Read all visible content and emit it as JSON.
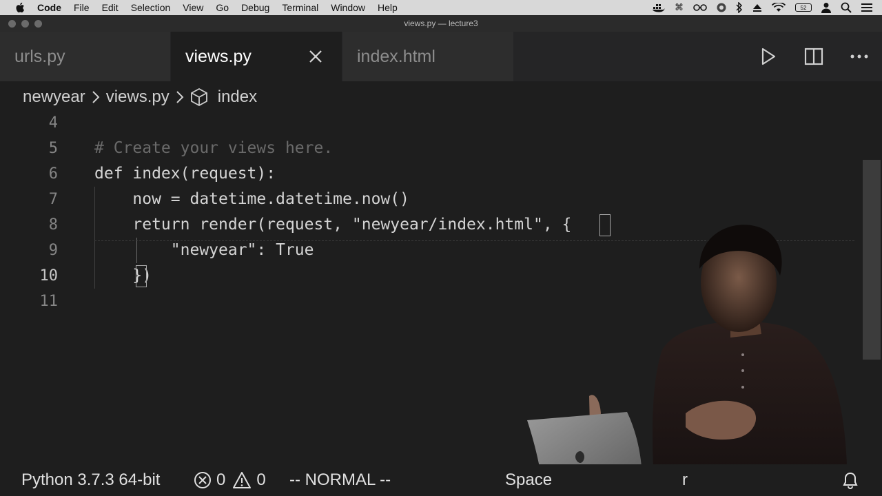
{
  "menubar": {
    "app_name": "Code",
    "items": [
      "File",
      "Edit",
      "Selection",
      "View",
      "Go",
      "Debug",
      "Terminal",
      "Window",
      "Help"
    ],
    "battery_text": "52"
  },
  "window": {
    "title": "views.py — lecture3"
  },
  "tabs": [
    {
      "label": "urls.py",
      "active": false
    },
    {
      "label": "views.py",
      "active": true
    },
    {
      "label": "index.html",
      "active": false
    }
  ],
  "breadcrumb": {
    "folder": "newyear",
    "file": "views.py",
    "symbol": "index"
  },
  "editor": {
    "lines": [
      {
        "number": "4",
        "text": ""
      },
      {
        "number": "5",
        "text": "# Create your views here."
      },
      {
        "number": "6",
        "text": "def index(request):"
      },
      {
        "number": "7",
        "text": "    now = datetime.datetime.now()"
      },
      {
        "number": "8",
        "text": "    return render(request, \"newyear/index.html\", {"
      },
      {
        "number": "9",
        "text": "        \"newyear\": True"
      },
      {
        "number": "10",
        "text": "    })"
      },
      {
        "number": "11",
        "text": ""
      }
    ],
    "current_line": "10"
  },
  "statusbar": {
    "interpreter": "Python 3.7.3 64-bit",
    "errors": "0",
    "warnings": "0",
    "mode": "-- NORMAL --",
    "indent": "Space",
    "partial": "r"
  },
  "colors": {
    "editor_bg": "#1e1e1e",
    "tab_inactive_bg": "#2d2d2d",
    "menubar_bg": "#d8d8d8",
    "comment": "#6a6a6a"
  }
}
